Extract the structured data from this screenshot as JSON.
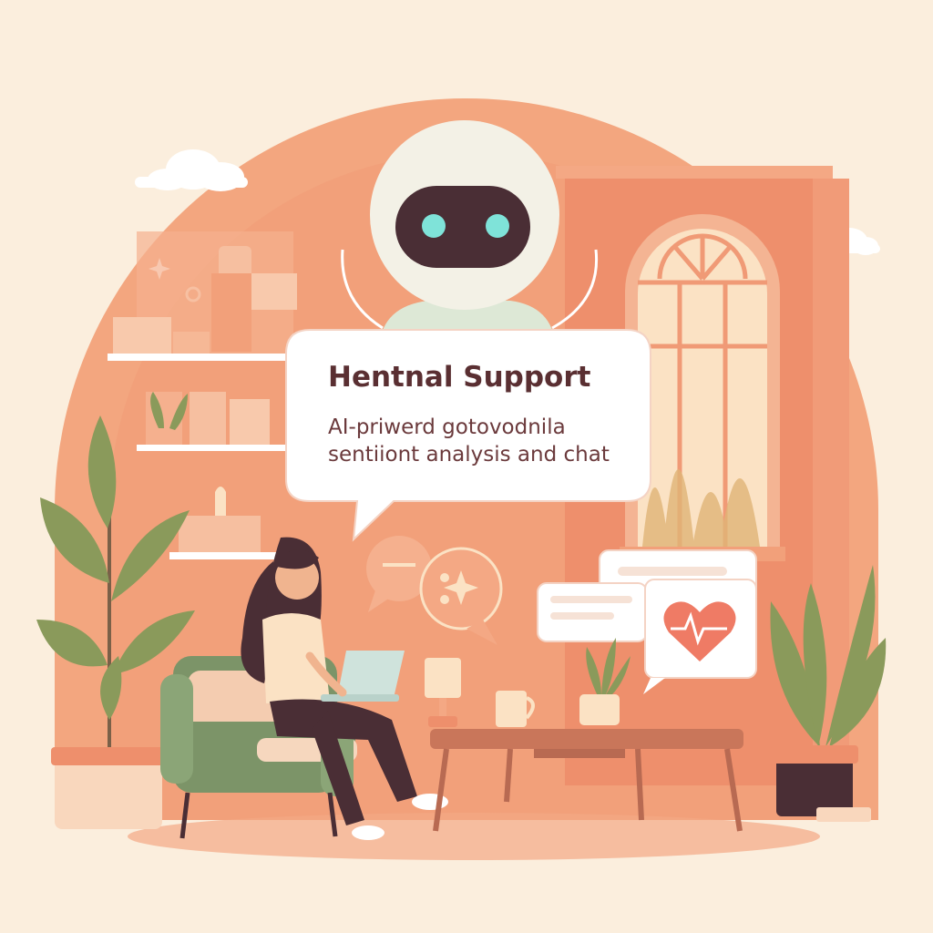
{
  "speech_bubble": {
    "title": "Hentnal Support",
    "line1": "AI-priwerd gotovodnila",
    "line2": "sentiiont analysis and chat"
  },
  "colors": {
    "background": "#fbeedd",
    "backdrop": "#f2a07a",
    "wall": "#ee8f6c",
    "robot_shell": "#f3f1e6",
    "robot_visor": "#4a2e35",
    "robot_eyes": "#7fe3d9",
    "plant_green": "#8a9a5b",
    "chair_green": "#7c9468",
    "wood": "#c9765a",
    "heart": "#ef7b65",
    "text_dark": "#5a2f32"
  },
  "icons": [
    "cloud-icon",
    "sparkle-icon",
    "gear-icon",
    "chat-bubble-icon",
    "heart-pulse-icon"
  ]
}
